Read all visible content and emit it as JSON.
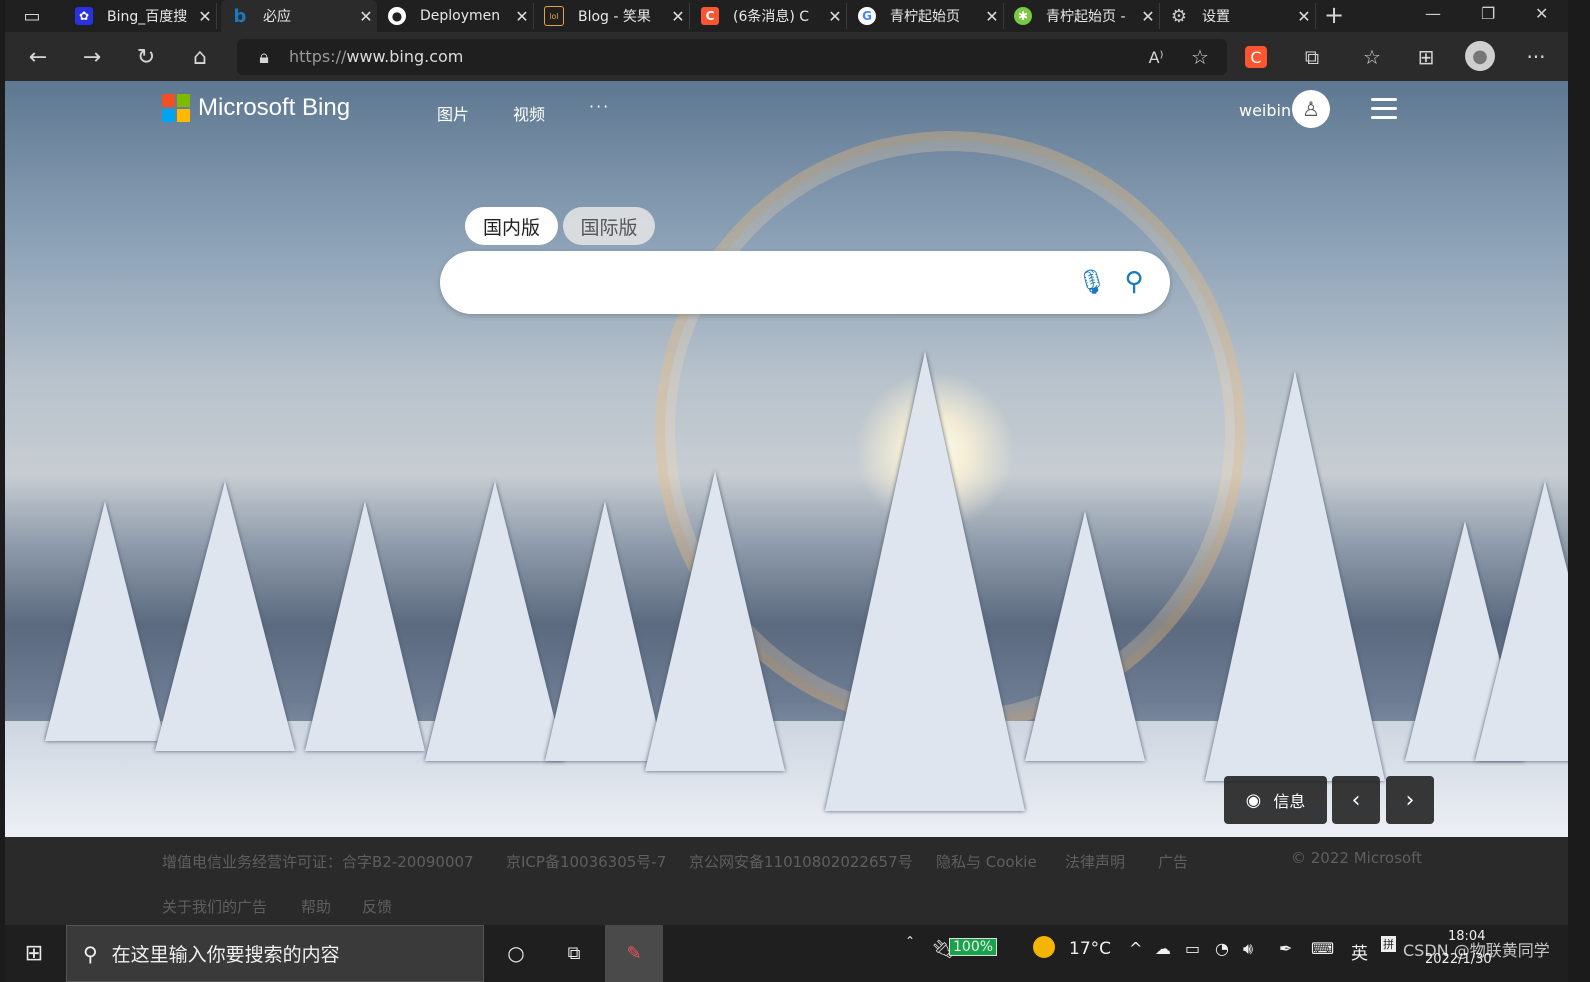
{
  "browser": {
    "tabs": [
      {
        "title": "Bing_百度搜",
        "icon": "baidu-icon",
        "color": "#2932e1"
      },
      {
        "title": "必应",
        "icon": "bing-icon",
        "color": "#1a7ac0",
        "active": true
      },
      {
        "title": "Deploymen",
        "icon": "github-icon",
        "color": "#ffffff"
      },
      {
        "title": "Blog - 笑果",
        "icon": "blog-icon",
        "color": "#e8a040"
      },
      {
        "title": "(6条消息) C",
        "icon": "csdn-icon",
        "color": "#fc5531"
      },
      {
        "title": "青柠起始页",
        "icon": "google-icon",
        "color": "#ffffff"
      },
      {
        "title": "青柠起始页 -",
        "icon": "lime-icon",
        "color": "#7ac943"
      },
      {
        "title": "设置",
        "icon": "gear-icon",
        "color": "#cccccc"
      }
    ],
    "new_tab": "+",
    "url_protocol": "https://",
    "url_host": "www.bing.com"
  },
  "bing": {
    "brand": "Microsoft Bing",
    "nav": [
      "图片",
      "视频",
      "···"
    ],
    "username": "weibin",
    "tabs": {
      "domestic": "国内版",
      "international": "国际版"
    },
    "search_placeholder": "",
    "info_label": "信息",
    "colors": {
      "accent": "#1a7ac0",
      "ms_red": "#f25022",
      "ms_green": "#7fba00",
      "ms_blue": "#00a4ef",
      "ms_yellow": "#ffb900"
    }
  },
  "footer": {
    "row1": [
      "增值电信业务经营许可证：合字B2-20090007",
      "京ICP备10036305号-7",
      "京公网安备11010802022657号",
      "隐私与 Cookie",
      "法律声明",
      "广告"
    ],
    "copyright": "© 2022 Microsoft",
    "row2": [
      "关于我们的广告",
      "帮助",
      "反馈"
    ]
  },
  "taskbar": {
    "search_text": "在这里输入你要搜索的内容",
    "battery": "100%",
    "weather": "17°C",
    "ime": "英",
    "time": "18:04",
    "date": "2022/1/30",
    "watermark": "CSDN @物联黄同学"
  }
}
